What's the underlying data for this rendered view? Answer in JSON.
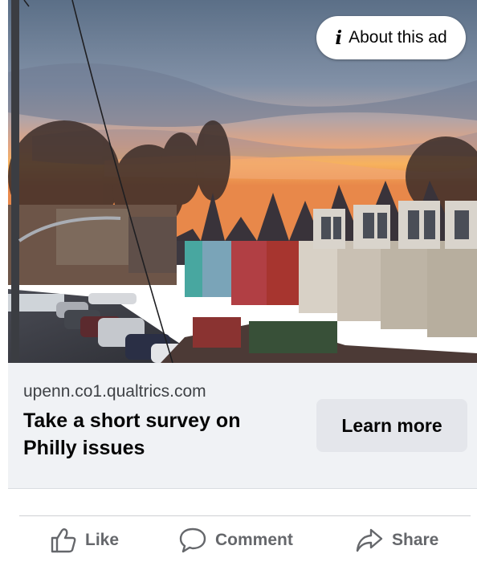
{
  "ad": {
    "about_label": "About this ad",
    "domain": "upenn.co1.qualtrics.com",
    "headline": "Take a short survey on Philly issues",
    "description": "",
    "cta_label": "Learn more",
    "info_icon": "i"
  },
  "actions": {
    "like_label": "Like",
    "comment_label": "Comment",
    "share_label": "Share"
  },
  "icons": {
    "about": "info-icon",
    "like": "thumbs-up-icon",
    "comment": "speech-bubble-icon",
    "share": "share-arrow-icon"
  },
  "colors": {
    "button_bg": "#e4e6eb",
    "footer_bg": "#f0f2f5",
    "action_gray": "#65676b",
    "text_dark": "#050505"
  }
}
